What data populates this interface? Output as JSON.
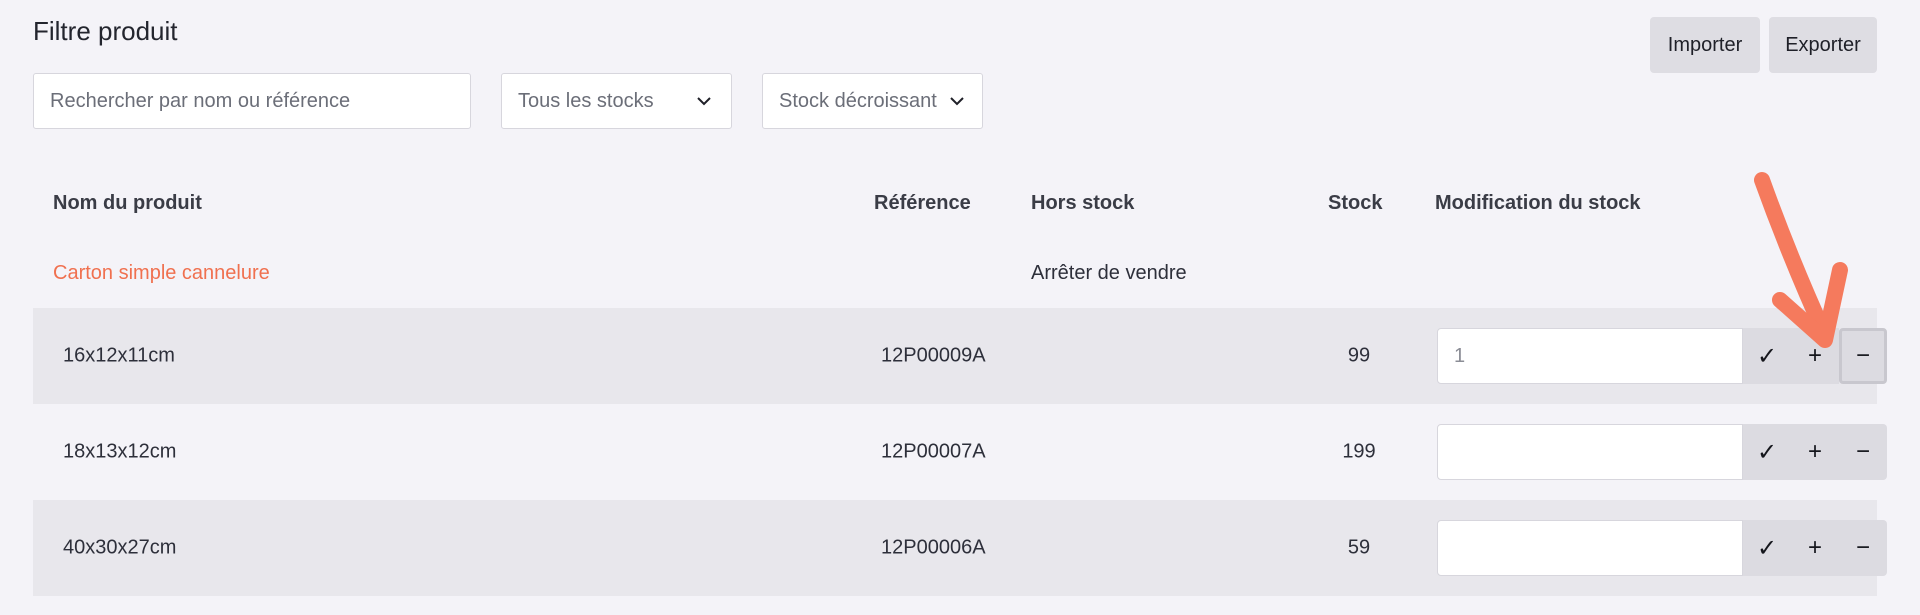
{
  "header": {
    "title": "Filtre produit",
    "import_label": "Importer",
    "export_label": "Exporter"
  },
  "filters": {
    "search_placeholder": "Rechercher par nom ou référence",
    "stock_filter": "Tous les stocks",
    "sort_order": "Stock décroissant"
  },
  "table": {
    "columns": [
      "Nom du produit",
      "Référence",
      "Hors stock",
      "Stock",
      "Modification du stock"
    ],
    "product": {
      "name": "Carton simple cannelure",
      "hors_stock": "Arrêter de vendre"
    },
    "rows": [
      {
        "name": "16x12x11cm",
        "reference": "12P00009A",
        "stock": "99",
        "modification": "1"
      },
      {
        "name": "18x13x12cm",
        "reference": "12P00007A",
        "stock": "199",
        "modification": ""
      },
      {
        "name": "40x30x27cm",
        "reference": "12P00006A",
        "stock": "59",
        "modification": ""
      }
    ],
    "actions": {
      "confirm_icon": "✓",
      "plus_icon": "+",
      "minus_icon": "−"
    }
  },
  "colors": {
    "accent_product": "#f0704f",
    "annotation_arrow": "#f57a5d"
  }
}
